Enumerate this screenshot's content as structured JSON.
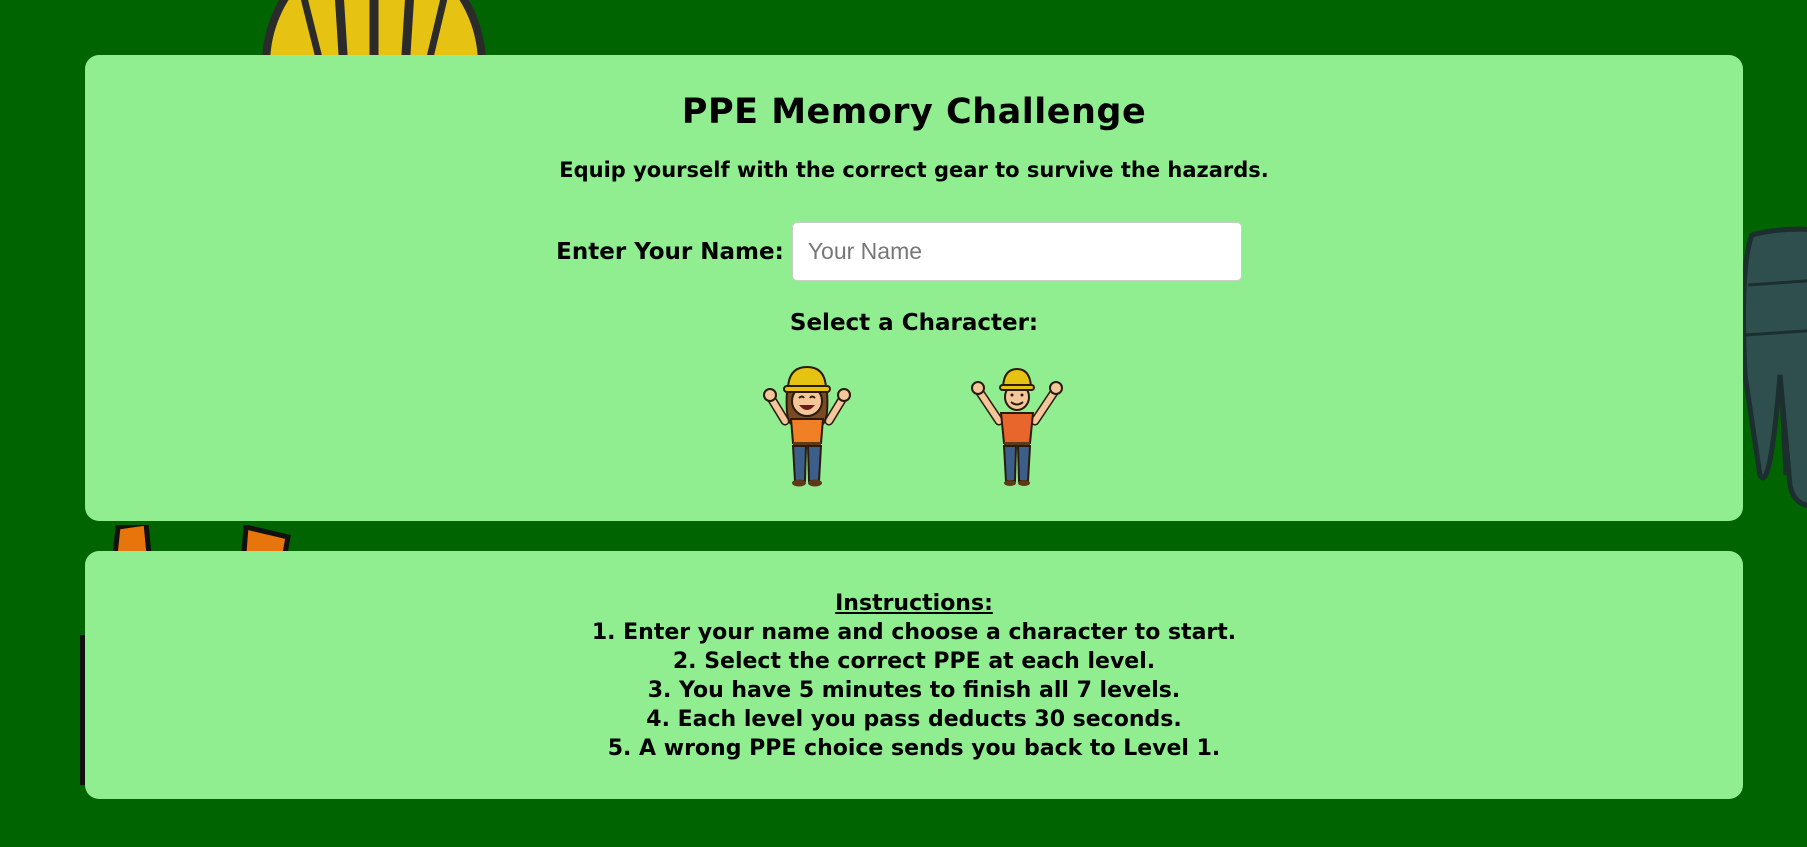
{
  "page": {
    "title": "PPE Memory Challenge",
    "subtitle": "Equip yourself with the correct gear to survive the hazards."
  },
  "name_field": {
    "label": "Enter Your Name:",
    "placeholder": "Your Name",
    "value": ""
  },
  "character_select": {
    "label": "Select a Character:",
    "characters": [
      {
        "name": "female-construction-worker-icon"
      },
      {
        "name": "male-construction-worker-icon"
      }
    ]
  },
  "instructions": {
    "heading": "Instructions:",
    "items": [
      "1. Enter your name and choose a character to start.",
      "2. Select the correct PPE at each level.",
      "3. You have 5 minutes to finish all 7 levels.",
      "4. Each level you pass deducts 30 seconds.",
      "5. A wrong PPE choice sends you back to Level 1."
    ]
  },
  "colors": {
    "background": "#006400",
    "card": "#90EE90",
    "helmet_yellow": "#E6C312",
    "shirt_orange": "#F07F25"
  }
}
